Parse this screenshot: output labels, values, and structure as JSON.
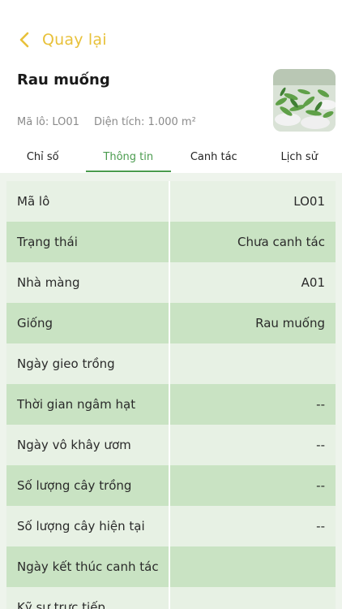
{
  "header": {
    "back_label": "Quay lại"
  },
  "lot": {
    "name": "Rau muống",
    "code_text": "Mã lô: LO01",
    "area_text": "Diện tích: 1.000 m²"
  },
  "tabs": [
    {
      "label": "Chỉ số",
      "active": false
    },
    {
      "label": "Thông tin",
      "active": true
    },
    {
      "label": "Canh tác",
      "active": false
    },
    {
      "label": "Lịch sử",
      "active": false
    }
  ],
  "info_rows": [
    {
      "label": "Mã lô",
      "value": "LO01"
    },
    {
      "label": "Trạng thái",
      "value": "Chưa canh tác"
    },
    {
      "label": "Nhà màng",
      "value": "A01"
    },
    {
      "label": "Giống",
      "value": "Rau muống"
    },
    {
      "label": "Ngày gieo trồng",
      "value": ""
    },
    {
      "label": "Thời gian ngâm hạt",
      "value": "--"
    },
    {
      "label": "Ngày vô khây ươm",
      "value": "--"
    },
    {
      "label": "Số lượng cây trồng",
      "value": "--"
    },
    {
      "label": "Số lượng cây hiện tại",
      "value": "--"
    },
    {
      "label": "Ngày kết thúc canh tác",
      "value": ""
    },
    {
      "label": "Kỹ sư trực tiếp",
      "value": ""
    }
  ],
  "colors": {
    "accent_yellow": "#e8c13a",
    "accent_green": "#4a9b4e",
    "row_light": "#e7f1e4",
    "row_dark": "#c9e3c3"
  }
}
